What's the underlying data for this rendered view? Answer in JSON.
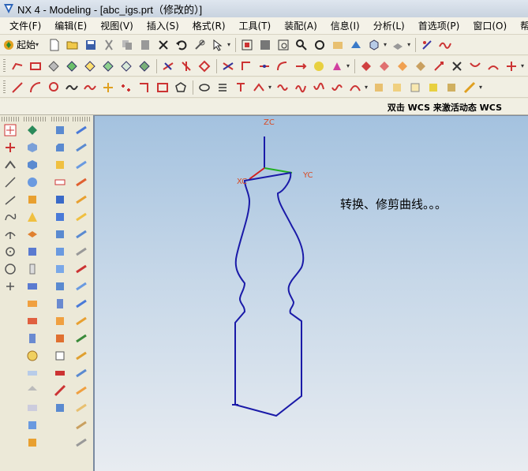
{
  "window": {
    "title": "NX 4 - Modeling - [abc_igs.prt（修改的）]"
  },
  "menu": {
    "items": [
      "文件(F)",
      "编辑(E)",
      "视图(V)",
      "插入(S)",
      "格式(R)",
      "工具(T)",
      "装配(A)",
      "信息(I)",
      "分析(L)",
      "首选项(P)",
      "窗口(O)",
      "帮助(H)"
    ]
  },
  "toolbar": {
    "start_label": "起始"
  },
  "status": {
    "message": "双击 WCS 来激活动态 WCS"
  },
  "viewport": {
    "axis_labels": {
      "z": "ZC",
      "y": "YC",
      "x": "XC"
    },
    "annotation": "转换、修剪曲线。。。",
    "colors": {
      "curve": "#1a1aa8",
      "z_axis": "#1a1aa8",
      "y_axis": "#22b022",
      "x_axis": "#d22020",
      "axis_label": "#d84a24",
      "bg_top": "#a4c2df",
      "bg_bottom": "#e8ecf1"
    }
  },
  "icons": {
    "toolbar_1": [
      "new-file-icon",
      "open-icon",
      "save-icon",
      "cut-icon",
      "copy-icon",
      "paste-icon",
      "delete-icon",
      "undo-icon",
      "repeat-icon",
      "select-icon",
      "fit-icon",
      "zoom-window-icon",
      "zoom-region-icon",
      "zoom-icon",
      "rotate-icon",
      "pan-icon",
      "shaded-icon",
      "view-orient-icon",
      "layer-icon",
      "drawing-icon",
      "sketch-icon"
    ],
    "toolbar_2": [
      "curve-tools-icons"
    ],
    "toolbar_3": [
      "line-icon",
      "arc-icon",
      "circle-icon",
      "spline-icon",
      "point-icon",
      "point-set-icon",
      "fillet-icon",
      "rectangle-icon",
      "polygon-icon",
      "ellipse-icon",
      "helix-icon",
      "text-icon"
    ]
  }
}
